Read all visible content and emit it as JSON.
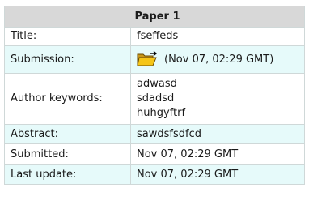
{
  "table": {
    "heading": "Paper 1",
    "title": {
      "label": "Title:",
      "value": "fseffeds"
    },
    "submission": {
      "label": "Submission:",
      "icon": "open-folder-icon",
      "value": "(Nov 07, 02:29 GMT)"
    },
    "author_keywords": {
      "label": "Author keywords:",
      "values": [
        "adwasd",
        "sdadsd",
        "huhgyftrf"
      ]
    },
    "abstract": {
      "label": "Abstract:",
      "value": "sawdsfsdfcd"
    },
    "submitted": {
      "label": "Submitted:",
      "value": "Nov 07, 02:29 GMT"
    },
    "last_update": {
      "label": "Last update:",
      "value": "Nov 07, 02:29 GMT"
    }
  },
  "colors": {
    "header_bg": "#d8d8d8",
    "tint_row_bg": "#e6fafa",
    "border": "#cfd8d8",
    "folder": "#f5c518"
  }
}
